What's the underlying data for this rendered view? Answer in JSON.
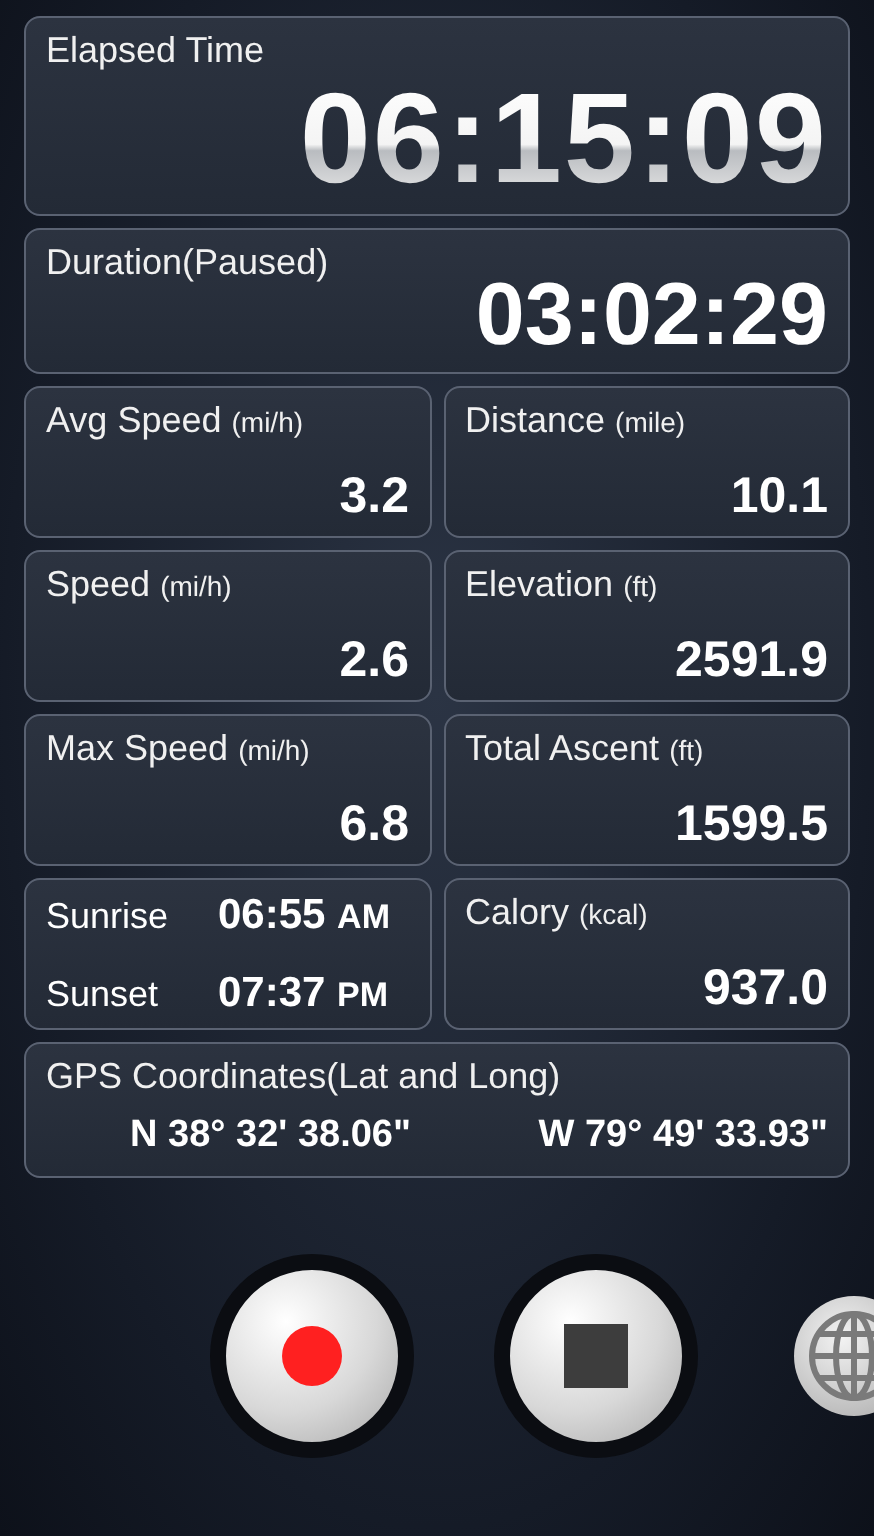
{
  "elapsed": {
    "label": "Elapsed Time",
    "value": "06:15:09"
  },
  "duration": {
    "label": "Duration(Paused)",
    "value": "03:02:29"
  },
  "tiles": [
    {
      "kind": "stat",
      "label": "Avg Speed",
      "unit": "(mi/h)",
      "value": "3.2"
    },
    {
      "kind": "stat",
      "label": "Distance",
      "unit": "(mile)",
      "value": "10.1"
    },
    {
      "kind": "stat",
      "label": "Speed",
      "unit": "(mi/h)",
      "value": "2.6"
    },
    {
      "kind": "stat",
      "label": "Elevation",
      "unit": "(ft)",
      "value": "2591.9"
    },
    {
      "kind": "stat",
      "label": "Max Speed",
      "unit": "(mi/h)",
      "value": "6.8"
    },
    {
      "kind": "stat",
      "label": "Total Ascent",
      "unit": "(ft)",
      "value": "1599.5"
    },
    {
      "kind": "sun",
      "rows": [
        {
          "label": "Sunrise",
          "time": "06:55",
          "suffix": "AM"
        },
        {
          "label": "Sunset",
          "time": "07:37",
          "suffix": "PM"
        }
      ]
    },
    {
      "kind": "stat",
      "label": "Calory",
      "unit": "(kcal)",
      "value": "937.0"
    }
  ],
  "gps": {
    "label": "GPS Coordinates(Lat and Long)",
    "lat": "N 38° 32' 38.06\"",
    "long": "W 79° 49' 33.93\""
  },
  "controls": [
    {
      "kind": "record"
    },
    {
      "kind": "stop"
    },
    {
      "kind": "globe"
    }
  ]
}
